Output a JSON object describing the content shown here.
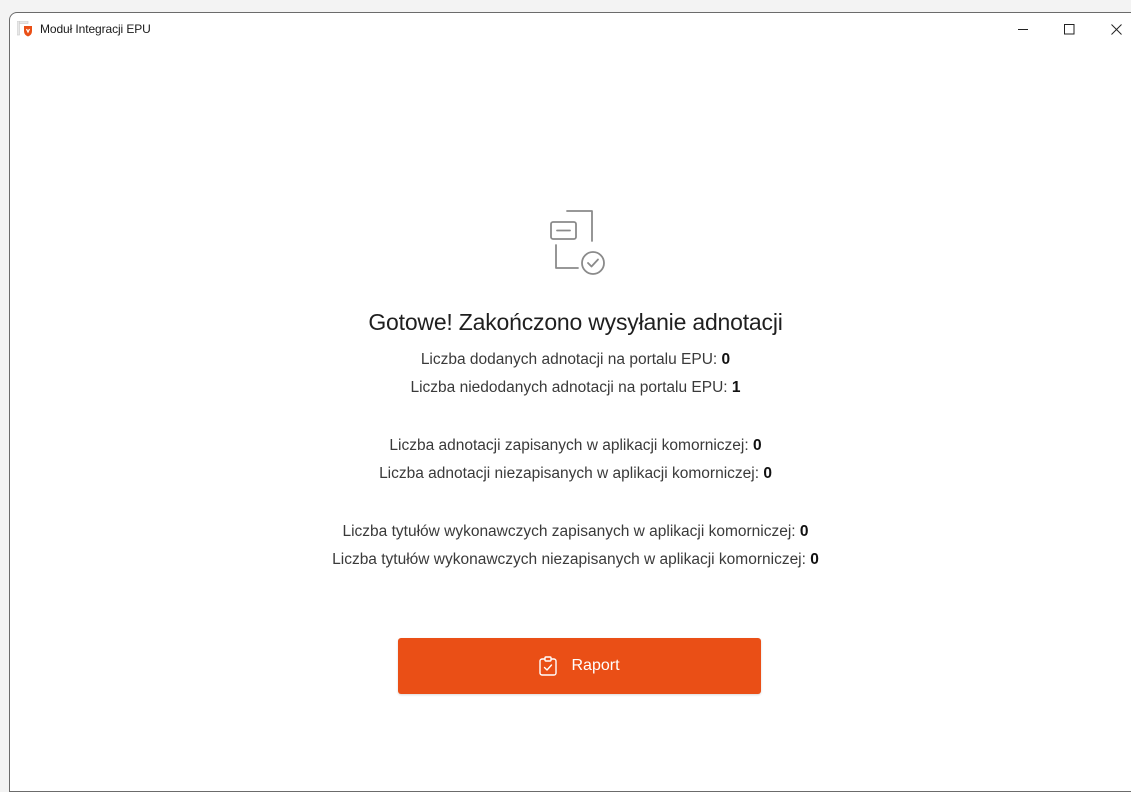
{
  "window": {
    "title": "Moduł Integracji EPU",
    "controls": {
      "minimize_icon": "minimize-icon",
      "maximize_icon": "maximize-icon",
      "close_icon": "close-icon"
    }
  },
  "main": {
    "icon": "document-check-icon",
    "heading": "Gotowe! Zakończono wysyłanie adnotacji",
    "stats": [
      {
        "label": "Liczba dodanych adnotacji na portalu EPU: ",
        "value": "0"
      },
      {
        "label": "Liczba niedodanych adnotacji na portalu EPU: ",
        "value": "1"
      },
      {
        "label": "Liczba adnotacji zapisanych w aplikacji komorniczej: ",
        "value": "0"
      },
      {
        "label": "Liczba adnotacji niezapisanych w aplikacji komorniczej: ",
        "value": "0"
      },
      {
        "label": "Liczba tytułów wykonawczych zapisanych w aplikacji komorniczej: ",
        "value": "0"
      },
      {
        "label": "Liczba tytułów wykonawczych niezapisanych w aplikacji komorniczej: ",
        "value": "0"
      }
    ],
    "report_button": {
      "label": "Raport",
      "icon": "clipboard-check-icon"
    }
  },
  "colors": {
    "accent": "#ea4f16",
    "text": "#3a3a3a",
    "heading": "#1f1f1f",
    "icon_stroke": "#8a8a8a"
  }
}
